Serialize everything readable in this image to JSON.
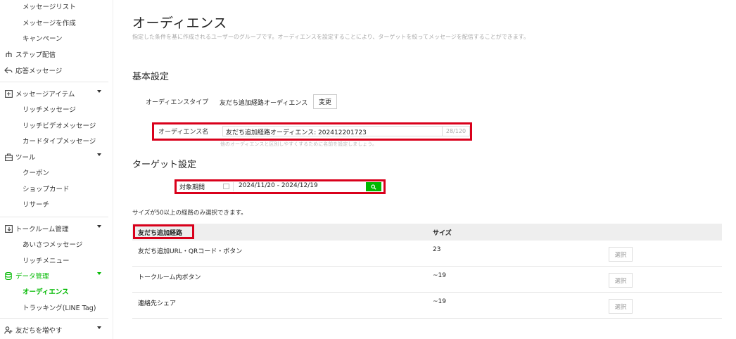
{
  "sidebar": {
    "items": [
      {
        "label": "メッセージリスト"
      },
      {
        "label": "メッセージを作成"
      },
      {
        "label": "キャンペーン"
      },
      {
        "label": "ステップ配信"
      },
      {
        "label": "応答メッセージ"
      },
      {
        "label": "メッセージアイテム"
      },
      {
        "label": "リッチメッセージ"
      },
      {
        "label": "リッチビデオメッセージ"
      },
      {
        "label": "カードタイプメッセージ"
      },
      {
        "label": "ツール"
      },
      {
        "label": "クーポン"
      },
      {
        "label": "ショップカード"
      },
      {
        "label": "リサーチ"
      },
      {
        "label": "トークルーム管理"
      },
      {
        "label": "あいさつメッセージ"
      },
      {
        "label": "リッチメニュー"
      },
      {
        "label": "データ管理"
      },
      {
        "label": "オーディエンス"
      },
      {
        "label": "トラッキング(LINE Tag)"
      },
      {
        "label": "友だちを増やす"
      }
    ]
  },
  "page": {
    "title": "オーディエンス",
    "description": "指定した条件を基に作成されるユーザーのグループです。オーディエンスを設定することにより、ターゲットを絞ってメッセージを配信することができます。"
  },
  "basic": {
    "section_title": "基本設定",
    "type_label": "オーディエンスタイプ",
    "type_value": "友だち追加経路オーディエンス",
    "change_label": "変更",
    "name_label": "オーディエンス名",
    "name_value": "友だち追加経路オーディエンス: 202412201723",
    "name_counter": "28/120",
    "name_hint": "他のオーディエンスと区別しやすくするために名前を設定しましょう。"
  },
  "target": {
    "section_title": "ターゲット設定",
    "period_label": "対象期間",
    "period_value": "2024/11/20 - 2024/12/19",
    "note": "サイズが50以上の経路のみ選択できます。"
  },
  "table": {
    "headers": [
      "友だち追加経路",
      "サイズ"
    ],
    "rows": [
      {
        "route": "友だち追加URL・QRコード・ボタン",
        "size": "23",
        "action": "選択"
      },
      {
        "route": "トークルーム内ボタン",
        "size": "~19",
        "action": "選択"
      },
      {
        "route": "連絡先シェア",
        "size": "~19",
        "action": "選択"
      }
    ]
  },
  "colors": {
    "accent": "#00b900",
    "highlight": "#d9001b",
    "table_header_bg": "#eeeeee"
  }
}
